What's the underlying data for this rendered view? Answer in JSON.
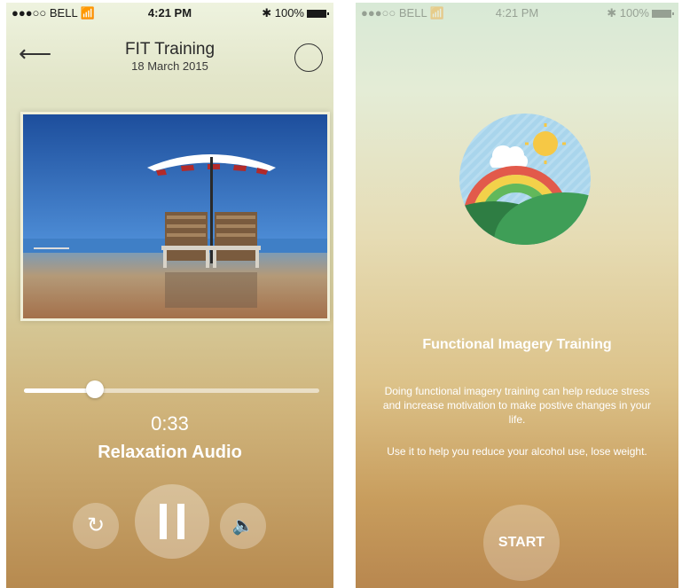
{
  "status_bar": {
    "carrier": "●●●○○ BELL 📶",
    "time": "4:21 PM",
    "battery": "✱ 100%"
  },
  "player": {
    "back_icon": "back-arrow-icon",
    "title": "FIT Training",
    "date": "18 March 2015",
    "action_icon": "circle-icon",
    "progress": 0.24,
    "elapsed": "0:33",
    "track_title": "Relaxation Audio",
    "controls": {
      "loop_icon": "loop-icon",
      "pause_icon": "pause-icon",
      "volume_icon": "volume-icon"
    }
  },
  "intro": {
    "heading": "Functional Imagery Training",
    "description": "Doing functional imagery training can help reduce stress and increase motivation to make postive changes in your life.",
    "description_2": "Use it to help you reduce your alcohol use, lose weight.",
    "start_label": "START"
  },
  "colors": {
    "circle_bg": "#a9d5ec",
    "hill_dark": "#2e7d43",
    "hill_light": "#3f9e57",
    "rainbow_red": "#e25a4b",
    "rainbow_yellow": "#f3d14a",
    "rainbow_green": "#62b85b",
    "sun": "#f6c845"
  }
}
